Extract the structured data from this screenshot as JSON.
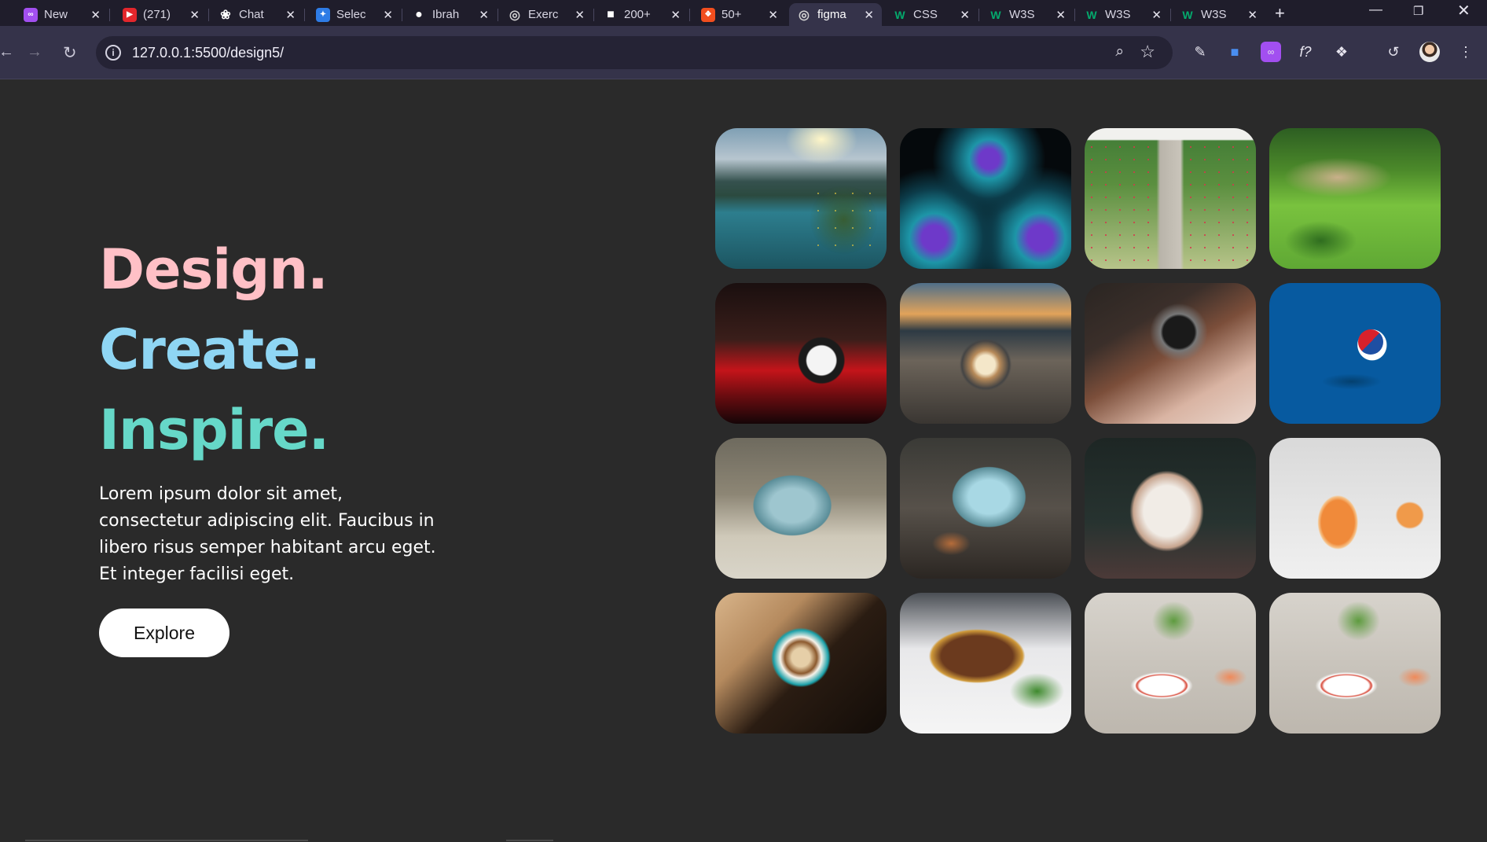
{
  "browser": {
    "tabs": [
      {
        "label": "New",
        "favicon": "browser-app-icon",
        "color": "#a24ff0"
      },
      {
        "label": "(271)",
        "favicon": "youtube-icon",
        "color": "#e3262c"
      },
      {
        "label": "Chat",
        "favicon": "chatgpt-icon",
        "color": "#ffffff"
      },
      {
        "label": "Selec",
        "favicon": "code-icon",
        "color": "#2e7ce6"
      },
      {
        "label": "Ibrah",
        "favicon": "github-icon",
        "color": "#ffffff"
      },
      {
        "label": "Exerc",
        "favicon": "globe-icon",
        "color": "#d0d0d0"
      },
      {
        "label": "200+",
        "favicon": "bag-icon",
        "color": "#ffffff"
      },
      {
        "label": "50+",
        "favicon": "figma-icon",
        "color": "#f24e1e"
      },
      {
        "label": "figma",
        "favicon": "globe-icon",
        "color": "#d0d0d0",
        "active": true
      },
      {
        "label": "CSS",
        "favicon": "w3schools-icon",
        "color": "#04aa6d"
      },
      {
        "label": "W3S",
        "favicon": "w3schools-icon",
        "color": "#04aa6d"
      },
      {
        "label": "W3S",
        "favicon": "w3schools-icon",
        "color": "#04aa6d"
      },
      {
        "label": "W3S",
        "favicon": "w3schools-icon",
        "color": "#04aa6d"
      }
    ],
    "url": "127.0.0.1:5500/design5/"
  },
  "hero": {
    "line1": "Design.",
    "line2": "Create.",
    "line3": "Inspire.",
    "description": "Lorem ipsum dolor sit amet, consectetur adipiscing elit. Faucibus in libero risus semper habitant arcu eget. Et integer facilisi eget.",
    "button_label": "Explore",
    "colors": {
      "design": "#ffc0c6",
      "create": "#8fd6f4",
      "inspire": "#66d8c8"
    }
  },
  "gallery": {
    "photos": [
      "mountain-lake",
      "teal-spiral-art",
      "rose-garden-path",
      "topiary-garden",
      "wristwatch",
      "crystal-ball-sunset",
      "vintage-camera",
      "pepsi-3d-logo",
      "crystal-skull",
      "crystal-skull-close",
      "white-cat",
      "iced-drink",
      "latte-art",
      "grilled-steak",
      "salad-plate",
      "salad-plate"
    ]
  }
}
